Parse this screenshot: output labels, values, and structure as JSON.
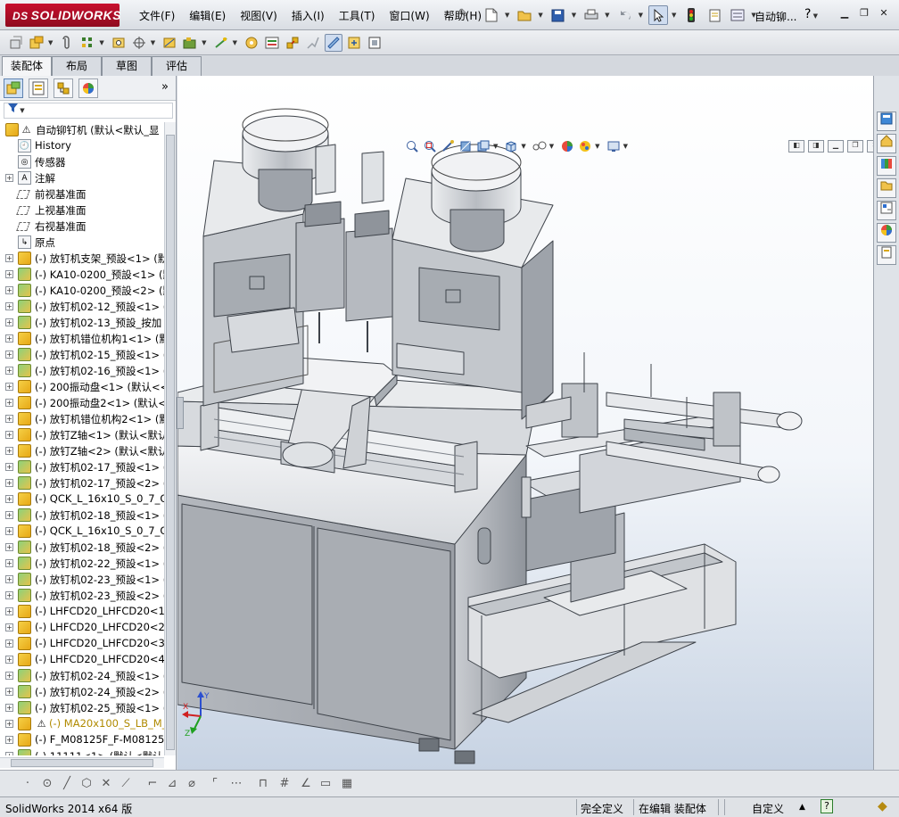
{
  "app": {
    "logo_text": "SOLIDWORKS",
    "logo_prefix": "DS",
    "document_title": "自动铆...",
    "help": "?"
  },
  "menu": [
    "文件(F)",
    "编辑(E)",
    "视图(V)",
    "插入(I)",
    "工具(T)",
    "窗口(W)",
    "帮助(H)"
  ],
  "command_tabs": [
    "装配体",
    "布局",
    "草图",
    "评估"
  ],
  "active_command_tab": "装配体",
  "feature_tree": {
    "filter_icon": "funnel-icon",
    "root": "自动铆钉机  (默认<默认_显",
    "items": [
      {
        "label": "History",
        "icon": "history-icon",
        "expandable": false
      },
      {
        "label": "传感器",
        "icon": "sensor-icon",
        "expandable": false
      },
      {
        "label": "注解",
        "icon": "annotation-icon",
        "expandable": true
      },
      {
        "label": "前视基准面",
        "icon": "plane-icon",
        "expandable": false
      },
      {
        "label": "上视基准面",
        "icon": "plane-icon",
        "expandable": false
      },
      {
        "label": "右视基准面",
        "icon": "plane-icon",
        "expandable": false
      },
      {
        "label": "原点",
        "icon": "origin-icon",
        "expandable": false
      },
      {
        "label": "(-) 放钉机支架_预設<1> (默",
        "icon": "assembly-icon",
        "expandable": true
      },
      {
        "label": "(-) KA10-0200_预設<1> (默",
        "icon": "part-icon",
        "expandable": true
      },
      {
        "label": "(-) KA10-0200_预設<2> (默",
        "icon": "part-icon",
        "expandable": true
      },
      {
        "label": "(-) 放钉机02-12_预設<1> (",
        "icon": "part-icon",
        "expandable": true
      },
      {
        "label": "(-) 放钉机02-13_预設_按加",
        "icon": "part-icon",
        "expandable": true
      },
      {
        "label": "(-) 放钉机错位机构1<1> (默",
        "icon": "assembly-icon",
        "expandable": true
      },
      {
        "label": "(-) 放钉机02-15_预設<1> (",
        "icon": "part-icon",
        "expandable": true
      },
      {
        "label": "(-) 放钉机02-16_预設<1> (",
        "icon": "part-icon",
        "expandable": true
      },
      {
        "label": "(-) 200振动盘<1> (默认<<",
        "icon": "assembly-icon",
        "expandable": true
      },
      {
        "label": "(-) 200振动盘2<1> (默认<",
        "icon": "assembly-icon",
        "expandable": true
      },
      {
        "label": "(-) 放钉机错位机构2<1> (默",
        "icon": "assembly-icon",
        "expandable": true
      },
      {
        "label": "(-) 放钉Z轴<1> (默认<默认",
        "icon": "assembly-icon",
        "expandable": true
      },
      {
        "label": "(-) 放钉Z轴<2> (默认<默认",
        "icon": "assembly-icon",
        "expandable": true
      },
      {
        "label": "(-) 放钉机02-17_预設<1> (",
        "icon": "part-icon",
        "expandable": true
      },
      {
        "label": "(-) 放钉机02-17_预設<2> (",
        "icon": "part-icon",
        "expandable": true
      },
      {
        "label": "(-) QCK_L_16x10_S_0_7_Q",
        "icon": "assembly-icon",
        "expandable": true
      },
      {
        "label": "(-) 放钉机02-18_预設<1> (",
        "icon": "part-icon",
        "expandable": true
      },
      {
        "label": "(-) QCK_L_16x10_S_0_7_Q",
        "icon": "assembly-icon",
        "expandable": true
      },
      {
        "label": "(-) 放钉机02-18_预設<2> (",
        "icon": "part-icon",
        "expandable": true
      },
      {
        "label": "(-) 放钉机02-22_预設<1> (",
        "icon": "part-icon",
        "expandable": true
      },
      {
        "label": "(-) 放钉机02-23_预設<1> (",
        "icon": "part-icon",
        "expandable": true
      },
      {
        "label": "(-) 放钉机02-23_预設<2> (",
        "icon": "part-icon",
        "expandable": true
      },
      {
        "label": "(-) LHFCD20_LHFCD20<1> (",
        "icon": "assembly-icon",
        "expandable": true
      },
      {
        "label": "(-) LHFCD20_LHFCD20<2> (",
        "icon": "assembly-icon",
        "expandable": true
      },
      {
        "label": "(-) LHFCD20_LHFCD20<3> (",
        "icon": "assembly-icon",
        "expandable": true
      },
      {
        "label": "(-) LHFCD20_LHFCD20<4> (",
        "icon": "assembly-icon",
        "expandable": true
      },
      {
        "label": "(-) 放钉机02-24_预設<1> (",
        "icon": "part-icon",
        "expandable": true
      },
      {
        "label": "(-) 放钉机02-24_预設<2> (",
        "icon": "part-icon",
        "expandable": true
      },
      {
        "label": "(-) 放钉机02-25_预設<1> (",
        "icon": "part-icon",
        "expandable": true
      },
      {
        "label": "(-) MA20x100_S_LB_M_2",
        "icon": "assembly-icon",
        "expandable": true,
        "warning": true
      },
      {
        "label": "(-) F_M08125F_F-M08125F-F",
        "icon": "assembly-icon",
        "expandable": true
      },
      {
        "label": "(-) 11111<1> (默认<默认_",
        "icon": "part-icon",
        "expandable": true
      }
    ]
  },
  "status": {
    "product": "SolidWorks 2014 x64 版",
    "definition": "完全定义",
    "editing": "在编辑 装配体",
    "units": "自定义",
    "help_badge": "?"
  },
  "colors": {
    "title_bg": "#dde1e6",
    "logo_red": "#c8102e",
    "viewport_top": "#ffffff",
    "viewport_bottom": "#c7d3e3",
    "model_light": "#e6e8eb",
    "model_mid": "#a5aab2",
    "model_dark": "#5d636b"
  }
}
